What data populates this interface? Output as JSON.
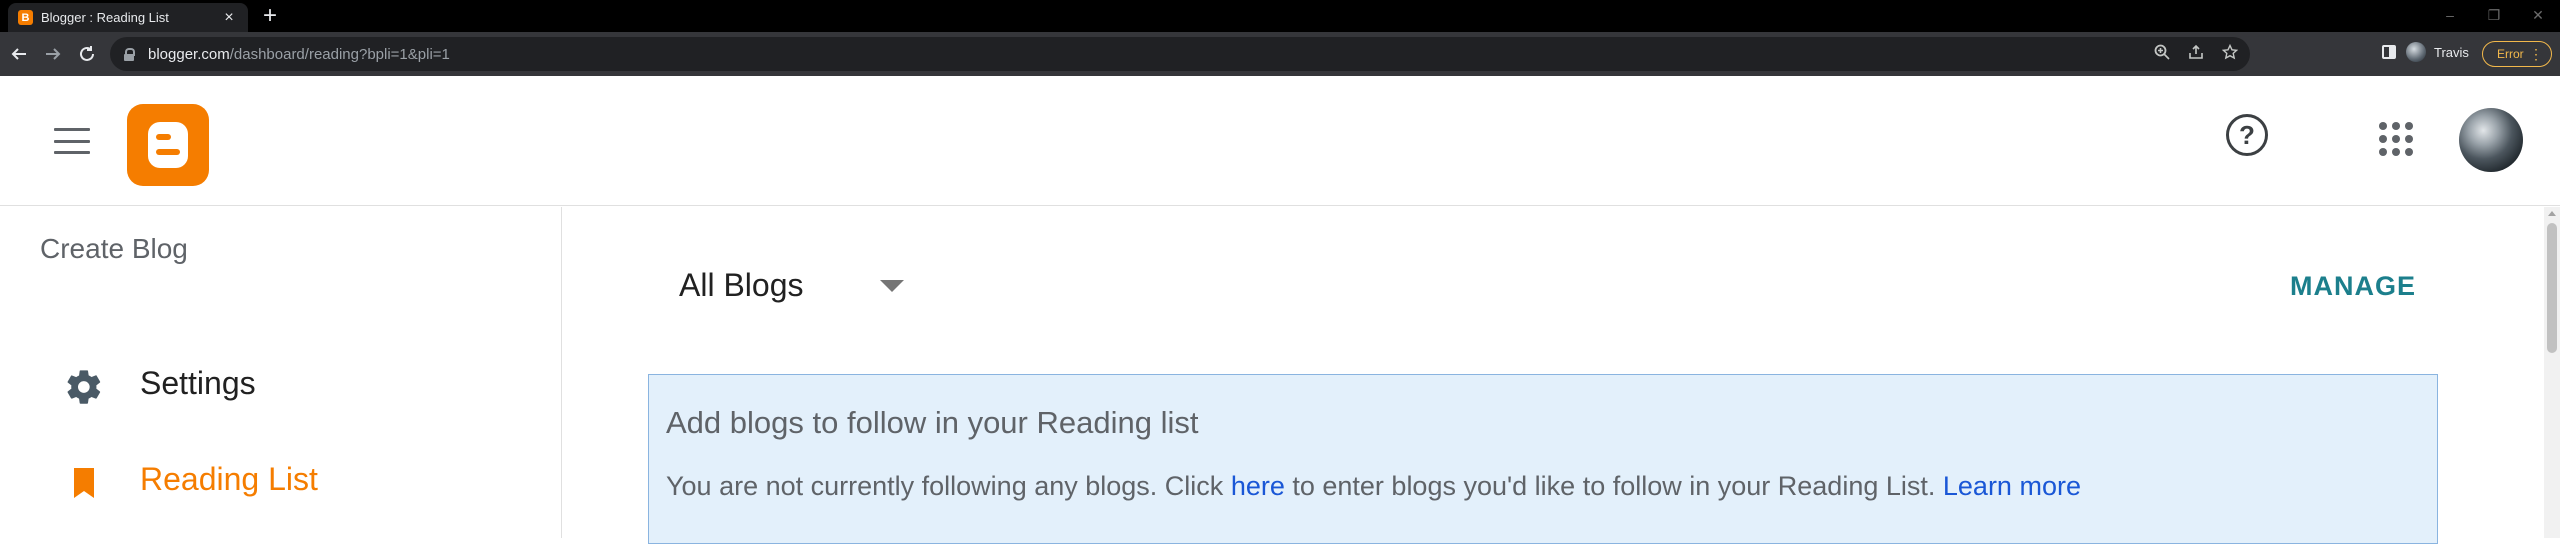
{
  "browser": {
    "tab": {
      "title": "Blogger : Reading List",
      "favicon_letter": "B",
      "close_label": "×"
    },
    "new_tab_label": "+",
    "window_controls": [
      "–",
      "❐",
      "✕"
    ],
    "url": {
      "host": "blogger.com",
      "path": "/dashboard/reading?bpli=1&pli=1"
    },
    "profile_name": "Travis",
    "error_label": "Error",
    "icons": [
      "back-icon",
      "forward-icon",
      "reload-icon",
      "lock-icon",
      "zoom-icon",
      "share-icon",
      "star-icon",
      "side-panel-icon",
      "kebab-menu-icon"
    ]
  },
  "header": {
    "icons": [
      "hamburger-menu-icon",
      "blogger-logo",
      "help-icon",
      "apps-grid-icon",
      "user-avatar"
    ],
    "help_glyph": "?"
  },
  "sidebar": {
    "create_blog": "Create Blog",
    "items": [
      {
        "label": "Settings",
        "icon": "gear-icon",
        "active": false
      },
      {
        "label": "Reading List",
        "icon": "bookmark-icon",
        "active": true
      }
    ]
  },
  "main": {
    "blog_select": {
      "value": "All Blogs"
    },
    "manage_label": "MANAGE",
    "info": {
      "title": "Add blogs to follow in your Reading list",
      "text_before": "You are not currently following any blogs. Click ",
      "here_link": "here",
      "text_after": " to enter blogs you'd like to follow in your Reading List. ",
      "learn_more": "Learn more"
    }
  },
  "colors": {
    "brand_orange": "#f57d00",
    "manage_teal": "#1c7f8c",
    "link_blue": "#1a57d6",
    "info_bg": "#e3f0fb",
    "error_amber": "#f2b84b"
  }
}
